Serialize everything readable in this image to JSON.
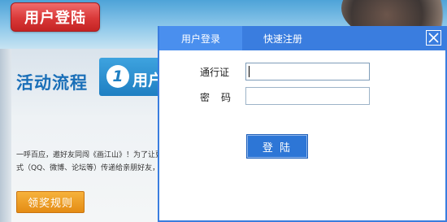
{
  "background": {
    "login_tab": "用户登陆",
    "flow_title": "活动流程",
    "step": {
      "number": "1",
      "label": "用户"
    },
    "intro_lines": [
      "一呼百应，邀好友同闯《画江山》！为了让更",
      "式（QQ、微博、论坛等）传递给亲朋好友，"
    ],
    "reward_button": "领奖规则"
  },
  "dialog": {
    "tabs": [
      {
        "label": "用户登录",
        "active": true
      },
      {
        "label": "快速注册",
        "active": false
      }
    ],
    "close_icon": "close-x-icon",
    "fields": {
      "account_label": "通行证",
      "account_value": "",
      "password_label": "密码",
      "password_value": ""
    },
    "submit_label": "登 陆"
  },
  "colors": {
    "dialog_accent": "#3a7ddf",
    "login_tab_red": "#d93838",
    "reward_orange": "#e48c14"
  }
}
